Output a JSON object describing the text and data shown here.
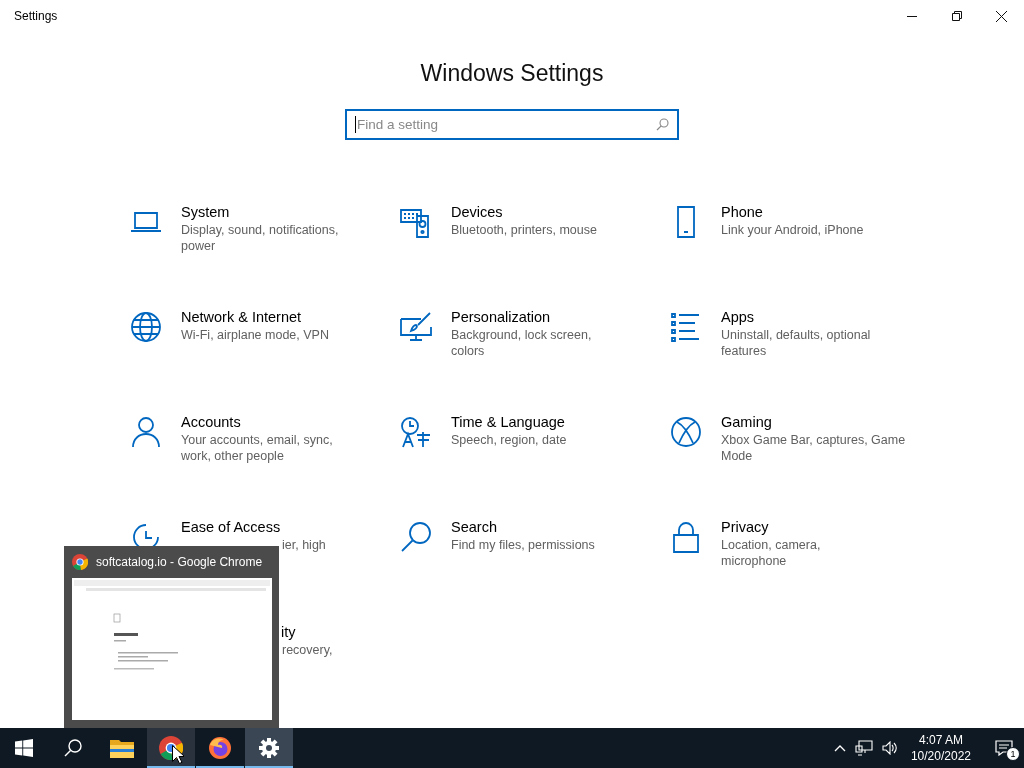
{
  "window": {
    "title": "Settings"
  },
  "heading": "Windows Settings",
  "search": {
    "placeholder": "Find a setting"
  },
  "categories": [
    {
      "kind": "tile",
      "title": "System",
      "subtitle": "Display, sound, notifications, power"
    },
    {
      "kind": "tile",
      "title": "Devices",
      "subtitle": "Bluetooth, printers, mouse"
    },
    {
      "kind": "tile",
      "title": "Phone",
      "subtitle": "Link your Android, iPhone"
    },
    {
      "kind": "tile",
      "title": "Network & Internet",
      "subtitle": "Wi-Fi, airplane mode, VPN"
    },
    {
      "kind": "tile",
      "title": "Personalization",
      "subtitle": "Background, lock screen, colors"
    },
    {
      "kind": "tile",
      "title": "Apps",
      "subtitle": "Uninstall, defaults, optional features"
    },
    {
      "kind": "tile",
      "title": "Accounts",
      "subtitle": "Your accounts, email, sync, work, other people"
    },
    {
      "kind": "tile",
      "title": "Time & Language",
      "subtitle": "Speech, region, date"
    },
    {
      "kind": "tile",
      "title": "Gaming",
      "subtitle": "Xbox Game Bar, captures, Game Mode"
    },
    {
      "kind": "partly-covered",
      "title": "Ease of Access",
      "subtitle": "ier, high"
    },
    {
      "kind": "tile",
      "title": "Search",
      "subtitle": "Find my files, permissions"
    },
    {
      "kind": "tile",
      "title": "Privacy",
      "subtitle": "Location, camera, microphone"
    },
    {
      "kind": "covered",
      "title": "ity",
      "subtitle": "recovery,"
    }
  ],
  "preview": {
    "title": "softcatalog.io - Google Chrome"
  },
  "taskbar": {
    "apps": [
      {
        "kind": "start",
        "hovered": false,
        "active": false,
        "running": false
      },
      {
        "kind": "search",
        "hovered": false,
        "active": false,
        "running": false
      },
      {
        "kind": "folder",
        "hovered": false,
        "active": false,
        "running": false
      },
      {
        "kind": "chrome",
        "hovered": true,
        "active": false,
        "running": true
      },
      {
        "kind": "firefox",
        "hovered": false,
        "active": false,
        "running": true
      },
      {
        "kind": "gear",
        "hovered": false,
        "active": true,
        "running": true
      }
    ],
    "time": "4:07 AM",
    "date": "10/20/2022",
    "notifications": "1"
  }
}
